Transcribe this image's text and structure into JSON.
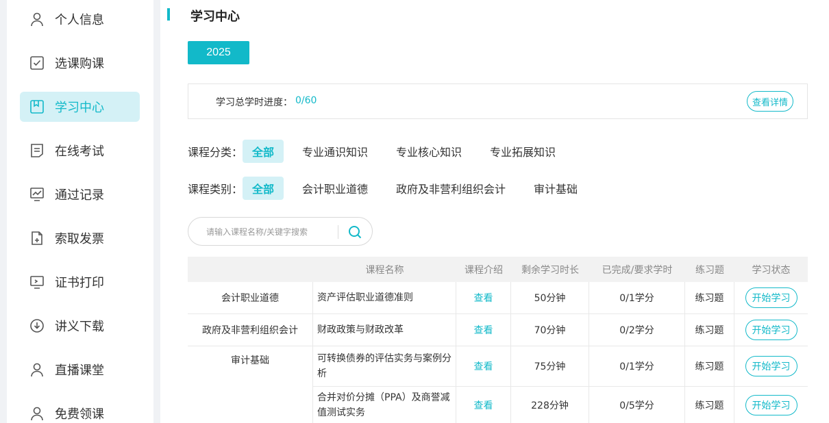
{
  "sidebar": {
    "items": [
      {
        "label": "个人信息",
        "icon": "user-icon",
        "active": false
      },
      {
        "label": "选课购课",
        "icon": "checkbox-icon",
        "active": false
      },
      {
        "label": "学习中心",
        "icon": "bookmark-icon",
        "active": true
      },
      {
        "label": "在线考试",
        "icon": "document-icon",
        "active": false
      },
      {
        "label": "通过记录",
        "icon": "chart-icon",
        "active": false
      },
      {
        "label": "索取发票",
        "icon": "invoice-icon",
        "active": false
      },
      {
        "label": "证书打印",
        "icon": "monitor-icon",
        "active": false
      },
      {
        "label": "讲义下载",
        "icon": "download-icon",
        "active": false
      },
      {
        "label": "直播课堂",
        "icon": "user-icon",
        "active": false
      },
      {
        "label": "免费领课",
        "icon": "user-icon",
        "active": false
      }
    ]
  },
  "main": {
    "title": "学习中心",
    "year": "2025",
    "progress_label": "学习总学时进度：",
    "progress_value": "0/60",
    "detail_button": "查看详情",
    "category_filter": {
      "label": "课程分类：",
      "options": [
        "全部",
        "专业通识知识",
        "专业核心知识",
        "专业拓展知识"
      ],
      "selected": 0
    },
    "type_filter": {
      "label": "课程类别：",
      "options": [
        "全部",
        "会计职业道德",
        "政府及非营利组织会计",
        "审计基础"
      ],
      "selected": 0
    },
    "search": {
      "placeholder": "请输入课程名称/关键字搜索",
      "value": ""
    },
    "table": {
      "headers": [
        "课程名称",
        "课程介绍",
        "剩余学习时长",
        "已完成/要求学时",
        "练习题",
        "学习状态"
      ],
      "groups": [
        {
          "category": "会计职业道德",
          "rows": [
            {
              "name": "资产评估职业道德准则",
              "intro": "查看",
              "remaining": "50分钟",
              "credits": "0/1学分",
              "exercise": "练习题",
              "status": "开始学习"
            }
          ]
        },
        {
          "category": "政府及非营利组织会计",
          "rows": [
            {
              "name": "财政政策与财政改革",
              "intro": "查看",
              "remaining": "70分钟",
              "credits": "0/2学分",
              "exercise": "练习题",
              "status": "开始学习"
            }
          ]
        },
        {
          "category": "审计基础",
          "rows": [
            {
              "name": "可转换债券的评估实务与案例分析",
              "intro": "查看",
              "remaining": "75分钟",
              "credits": "0/1学分",
              "exercise": "练习题",
              "status": "开始学习"
            },
            {
              "name": "合并对价分摊（PPA）及商誉减值测试实务",
              "intro": "查看",
              "remaining": "228分钟",
              "credits": "0/5学分",
              "exercise": "练习题",
              "status": "开始学习"
            }
          ]
        }
      ]
    }
  },
  "colors": {
    "accent": "#12b9c9",
    "accent_light": "#d4f1f6"
  }
}
